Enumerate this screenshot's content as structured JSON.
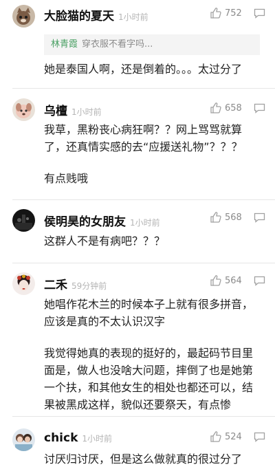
{
  "comments": [
    {
      "username": "大脸猫的夏天",
      "time": "1小时前",
      "likes": "752",
      "avatar_icon": "cat-avatar-icon",
      "quote": {
        "user": "林青霞",
        "text": "穿衣服不看字吗..."
      },
      "paragraphs": [
        "她是泰国人啊，还是倒着的。。。太过分了"
      ]
    },
    {
      "username": "乌檀",
      "time": "1小时前",
      "likes": "658",
      "avatar_icon": "dog-avatar-icon",
      "paragraphs": [
        "我草，黑粉丧心病狂啊？？网上骂骂就算了，还真情实感的去“应援送礼物”？？？",
        "有点贱哦"
      ]
    },
    {
      "username": "侯明昊的女朋友",
      "time": "1小时前",
      "likes": "568",
      "avatar_icon": "dark-scene-avatar-icon",
      "paragraphs": [
        "这群人不是有病吧？？？"
      ]
    },
    {
      "username": "二禾",
      "time": "59分钟前",
      "likes": "564",
      "avatar_icon": "opera-mask-avatar-icon",
      "paragraphs": [
        "她唱作花木兰的时候本子上就有很多拼音，应该是真的不太认识汉字",
        "我觉得她真的表现的挺好的，最起码节目里面是，做人也没啥大问题，摔倒了也是她第一个扶，和其他女生的相处也都还可以，结果被黑成这样，貌似还要祭天，有点惨"
      ]
    },
    {
      "username": "chick",
      "time": "1小时前",
      "likes": "524",
      "avatar_icon": "couple-photo-avatar-icon",
      "paragraphs": [
        "讨厌归讨厌，但是这么做就真的很过分了"
      ]
    }
  ],
  "colors": {
    "username": "#111111",
    "time": "#b4b4b4",
    "quote_user": "#4aa064",
    "divider": "#e6e6e6"
  }
}
